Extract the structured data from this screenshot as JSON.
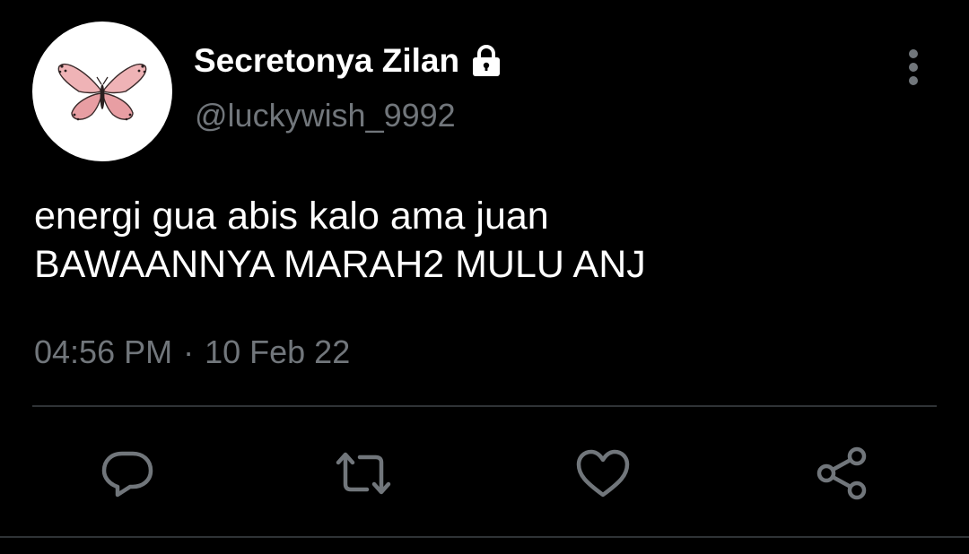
{
  "user": {
    "display_name": "Secretonya Zilan",
    "handle": "@luckywish_9992",
    "avatar": "pink-butterfly-icon",
    "protected_icon": "lock-icon"
  },
  "tweet": {
    "lines": [
      "energi gua abis kalo ama juan",
      "BAWAANNYA MARAH2 MULU ANJ"
    ],
    "time": "04:56 PM",
    "separator": "·",
    "date": "10 Feb 22"
  },
  "actions": {
    "reply": "reply-icon",
    "retweet": "retweet-icon",
    "like": "heart-icon",
    "share": "share-icon",
    "more": "more-vertical-icon"
  },
  "colors": {
    "background": "#000000",
    "primary_text": "#ffffff",
    "secondary_text": "#71767b",
    "divider": "#2f3336",
    "icon": "#71767b",
    "butterfly": "#e8a4a8"
  }
}
